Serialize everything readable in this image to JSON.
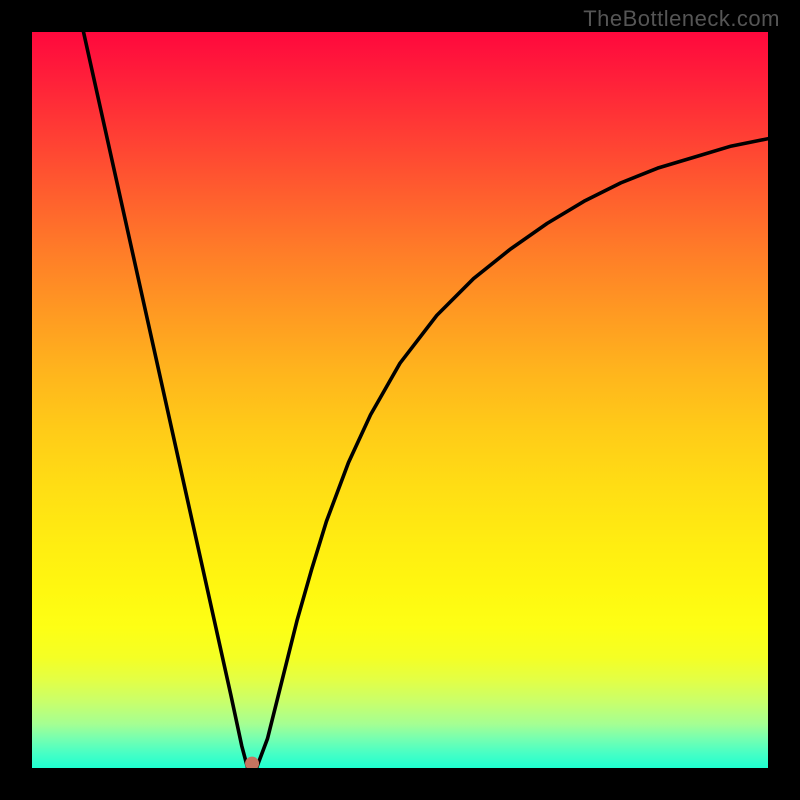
{
  "watermark_text": "TheBottleneck.com",
  "chart_data": {
    "type": "line",
    "title": "",
    "xlabel": "",
    "ylabel": "",
    "xlim": [
      0,
      100
    ],
    "ylim": [
      0,
      100
    ],
    "background_gradient": {
      "direction": "vertical",
      "stops": [
        {
          "t": 0.0,
          "color": "#ff083d"
        },
        {
          "t": 0.5,
          "color": "#ffcc18"
        },
        {
          "t": 0.8,
          "color": "#fff810"
        },
        {
          "t": 1.0,
          "color": "#1fffd0"
        }
      ],
      "meaning": "red (top) to green (bottom)"
    },
    "series": [
      {
        "name": "curve",
        "description": "Black V-shaped bottleneck curve with minimum near x≈29, rising toward 100 on the left edge and toward mid-80s on the right edge",
        "points": [
          {
            "x": 7.0,
            "y": 100.0
          },
          {
            "x": 9.0,
            "y": 91.0
          },
          {
            "x": 11.0,
            "y": 82.0
          },
          {
            "x": 13.0,
            "y": 73.0
          },
          {
            "x": 15.0,
            "y": 64.0
          },
          {
            "x": 17.0,
            "y": 55.0
          },
          {
            "x": 19.0,
            "y": 46.0
          },
          {
            "x": 21.0,
            "y": 37.0
          },
          {
            "x": 23.0,
            "y": 28.0
          },
          {
            "x": 25.0,
            "y": 19.0
          },
          {
            "x": 27.0,
            "y": 10.0
          },
          {
            "x": 28.5,
            "y": 3.0
          },
          {
            "x": 29.3,
            "y": 0.0
          },
          {
            "x": 30.5,
            "y": 0.0
          },
          {
            "x": 32.0,
            "y": 4.0
          },
          {
            "x": 34.0,
            "y": 12.0
          },
          {
            "x": 36.0,
            "y": 20.0
          },
          {
            "x": 38.0,
            "y": 27.0
          },
          {
            "x": 40.0,
            "y": 33.5
          },
          {
            "x": 43.0,
            "y": 41.5
          },
          {
            "x": 46.0,
            "y": 48.0
          },
          {
            "x": 50.0,
            "y": 55.0
          },
          {
            "x": 55.0,
            "y": 61.5
          },
          {
            "x": 60.0,
            "y": 66.5
          },
          {
            "x": 65.0,
            "y": 70.5
          },
          {
            "x": 70.0,
            "y": 74.0
          },
          {
            "x": 75.0,
            "y": 77.0
          },
          {
            "x": 80.0,
            "y": 79.5
          },
          {
            "x": 85.0,
            "y": 81.5
          },
          {
            "x": 90.0,
            "y": 83.0
          },
          {
            "x": 95.0,
            "y": 84.5
          },
          {
            "x": 100.0,
            "y": 85.5
          }
        ]
      }
    ],
    "marker": {
      "description": "Small salmon dot at the curve minimum",
      "x": 29.9,
      "y": 0.6,
      "color": "#c67460"
    },
    "grid": false,
    "legend": false
  }
}
